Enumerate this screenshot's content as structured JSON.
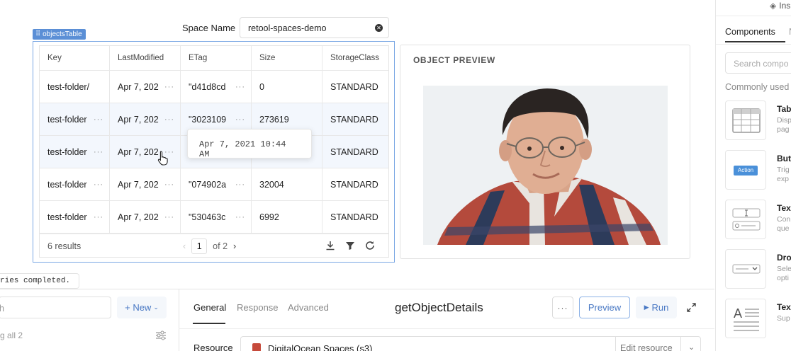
{
  "space": {
    "label": "Space Name",
    "value": "retool-spaces-demo"
  },
  "table": {
    "tag": "objectsTable",
    "columns": [
      "Key",
      "LastModified",
      "ETag",
      "Size",
      "StorageClass"
    ],
    "rows": [
      [
        "test-folder/",
        "Apr 7, 202",
        "\"d41d8cd",
        "0",
        "STANDARD"
      ],
      [
        "test-folder",
        "Apr 7, 202",
        "\"3023109",
        "273619",
        "STANDARD"
      ],
      [
        "test-folder",
        "Apr 7, 202",
        "",
        "",
        "STANDARD"
      ],
      [
        "test-folder",
        "Apr 7, 202",
        "\"074902a",
        "32004",
        "STANDARD"
      ],
      [
        "test-folder",
        "Apr 7, 202",
        "\"530463c",
        "6992",
        "STANDARD"
      ]
    ],
    "results": "6 results",
    "page": "1",
    "of_pages": "of 2",
    "tooltip": "Apr 7, 2021 10:44 AM"
  },
  "preview": {
    "title": "OBJECT PREVIEW"
  },
  "right_panel": {
    "top_label": "Ins",
    "tab_components": "Components",
    "tab_other": "N",
    "search_placeholder": "Search compo",
    "commonly_used": "Commonly used",
    "components": [
      {
        "name": "Tab",
        "desc1": "Disp",
        "desc2": "pag",
        "icon": "table-icon"
      },
      {
        "name": "But",
        "desc1": "Trig",
        "desc2": "exp",
        "icon": "button-icon",
        "badge": "Action"
      },
      {
        "name": "Tex",
        "desc1": "Con",
        "desc2": "que",
        "icon": "text-input-icon"
      },
      {
        "name": "Dro",
        "desc1": "Sele",
        "desc2": "opti",
        "icon": "dropdown-icon"
      },
      {
        "name": "Tex",
        "desc1": "Sup",
        "desc2": "",
        "icon": "text-icon"
      }
    ]
  },
  "status": {
    "text": "ries completed."
  },
  "query_panel": {
    "search_placeholder": "h",
    "new_label": "+ New",
    "run_all": "g all 2",
    "tabs": [
      "General",
      "Response",
      "Advanced"
    ],
    "query_name": "getObjectDetails",
    "more": "···",
    "preview_btn": "Preview",
    "run_btn": "Run",
    "resource_label": "Resource",
    "resource_name": "DigitalOcean Spaces (s3)",
    "edit_resource": "Edit resource"
  },
  "colors": {
    "accent": "#4a79c4",
    "selection": "#7aa7e4",
    "row_alt": "#f3f7fd"
  }
}
